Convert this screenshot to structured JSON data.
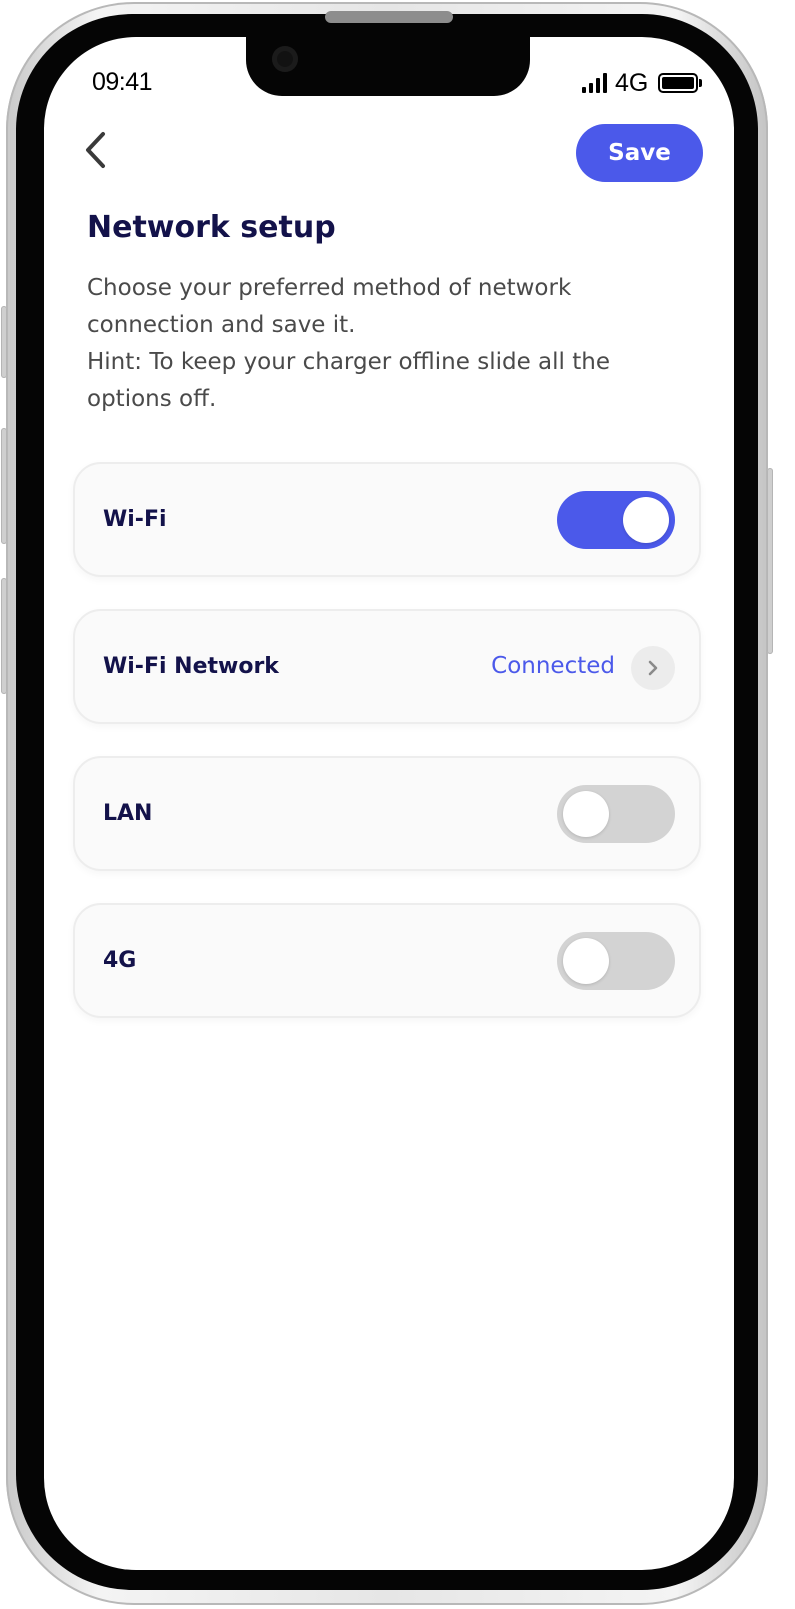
{
  "status_bar": {
    "time": "09:41",
    "network": "4G",
    "icons": [
      "signal-icon",
      "battery-icon"
    ]
  },
  "header": {
    "back_icon": "chevron-left-icon",
    "save_label": "Save"
  },
  "page": {
    "title": "Network setup",
    "description_line1": "Choose your preferred method of network connection and save it.",
    "description_line2": "Hint: To keep your charger offline slide all the options off."
  },
  "options": [
    {
      "label": "Wi-Fi",
      "control": "toggle",
      "enabled": true
    },
    {
      "label": "Wi-Fi Network",
      "control": "link",
      "status": "Connected",
      "icon": "chevron-right-icon"
    },
    {
      "label": "LAN",
      "control": "toggle",
      "enabled": false
    },
    {
      "label": "4G",
      "control": "toggle",
      "enabled": false
    }
  ],
  "colors": {
    "accent": "#4b59ea",
    "title_text": "#13124a",
    "body_text": "#4a4a4a",
    "toggle_off": "#d3d3d3",
    "card_background": "#fafafa"
  }
}
